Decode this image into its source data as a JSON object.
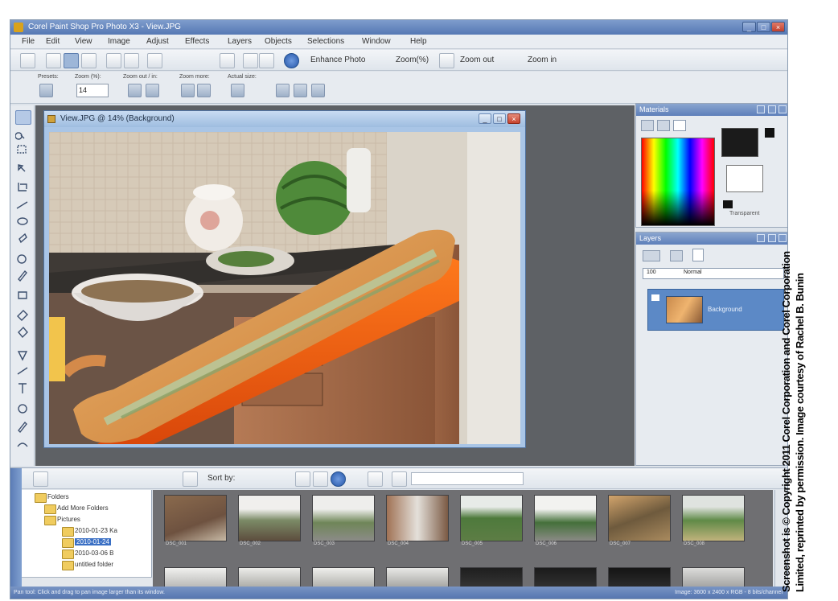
{
  "window": {
    "title": "Corel Paint Shop Pro Photo X3 - View.JPG"
  },
  "menu": [
    "File",
    "Edit",
    "View",
    "Image",
    "Adjust",
    "Effects",
    "Layers",
    "Objects",
    "Selections",
    "Window",
    "Help"
  ],
  "toolbar": {
    "enhance_label": "Enhance Photo",
    "zoom_value": "Zoom(%)",
    "zoom_out_label": "Zoom out",
    "zoom_in_label": "Zoom in"
  },
  "tool_options": {
    "labels": [
      "Presets:",
      "Zoom (%):",
      "Zoom out / in:",
      "Zoom more:",
      "Actual size:"
    ],
    "zoom_value": "14"
  },
  "document": {
    "title": "View.JPG @ 14% (Background)"
  },
  "materials": {
    "title": "Materials",
    "label_bottom": "Transparent"
  },
  "layers": {
    "title": "Layers",
    "mode": "Normal",
    "opacity": "100",
    "layer_name": "Background"
  },
  "organizer": {
    "tree": [
      "Folders",
      "Add More Folders",
      "Pictures",
      "2010-01-23 Ka",
      "2010-01-24",
      "2010-03-06 B",
      "untitled folder"
    ],
    "thumb_labels": [
      "DSC_001",
      "DSC_002",
      "DSC_003",
      "DSC_004",
      "DSC_005",
      "DSC_006",
      "DSC_007",
      "DSC_008"
    ],
    "sort_label": "Sort by:"
  },
  "status": {
    "left": "Pan tool: Click and drag to pan image larger than its window.",
    "right": "Image: 3600 x 2400 x RGB - 8 bits/channel"
  },
  "copyright": {
    "line1": "Screenshot is © Copyright 2011 Corel Corporation and Corel Corporation",
    "line2": "Limited, reprinted by permission. Image courtesy of Rachel B. Bunin"
  },
  "colors": {
    "title_bar": "#5578b4",
    "workspace": "#5e6165",
    "doc_frame": "#a9c5e6"
  }
}
